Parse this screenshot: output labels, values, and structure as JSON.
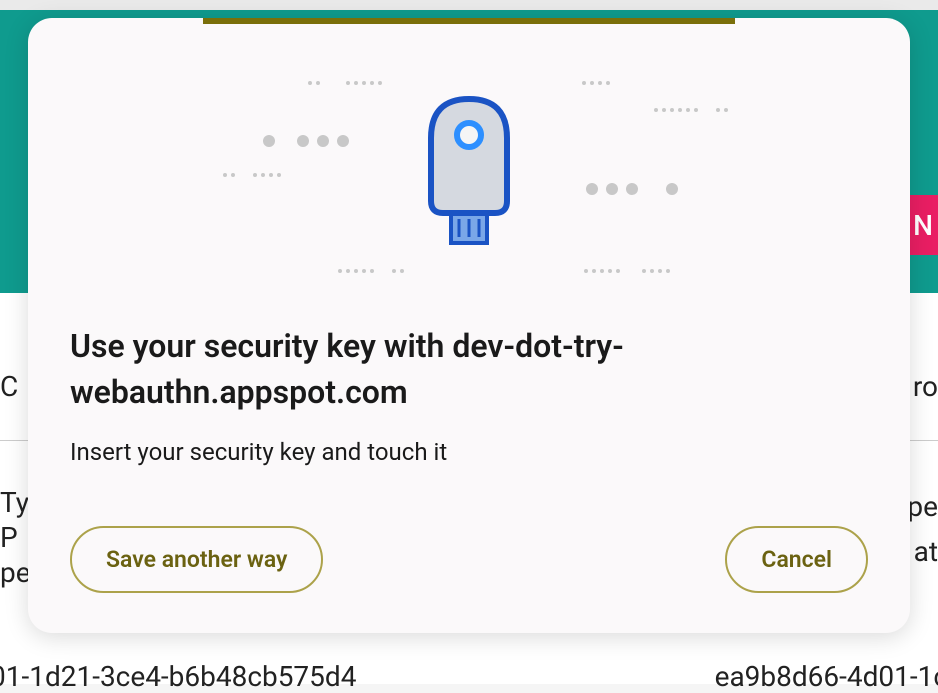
{
  "backdrop": {
    "pink_letter": "N",
    "left_text_1": "C",
    "right_text_1": "ro",
    "left_text_2": "Ty\nP\npe",
    "right_text_2": "pe\nat",
    "bottom_left": "01-1d21-3ce4-b6b48cb575d4",
    "bottom_right": "ea9b8d66-4d01-1c"
  },
  "dialog": {
    "title": "Use your security key with dev-dot-try-webauthn.appspot.com",
    "subtitle": "Insert your security key and touch it",
    "save_another_way": "Save another way",
    "cancel": "Cancel"
  }
}
